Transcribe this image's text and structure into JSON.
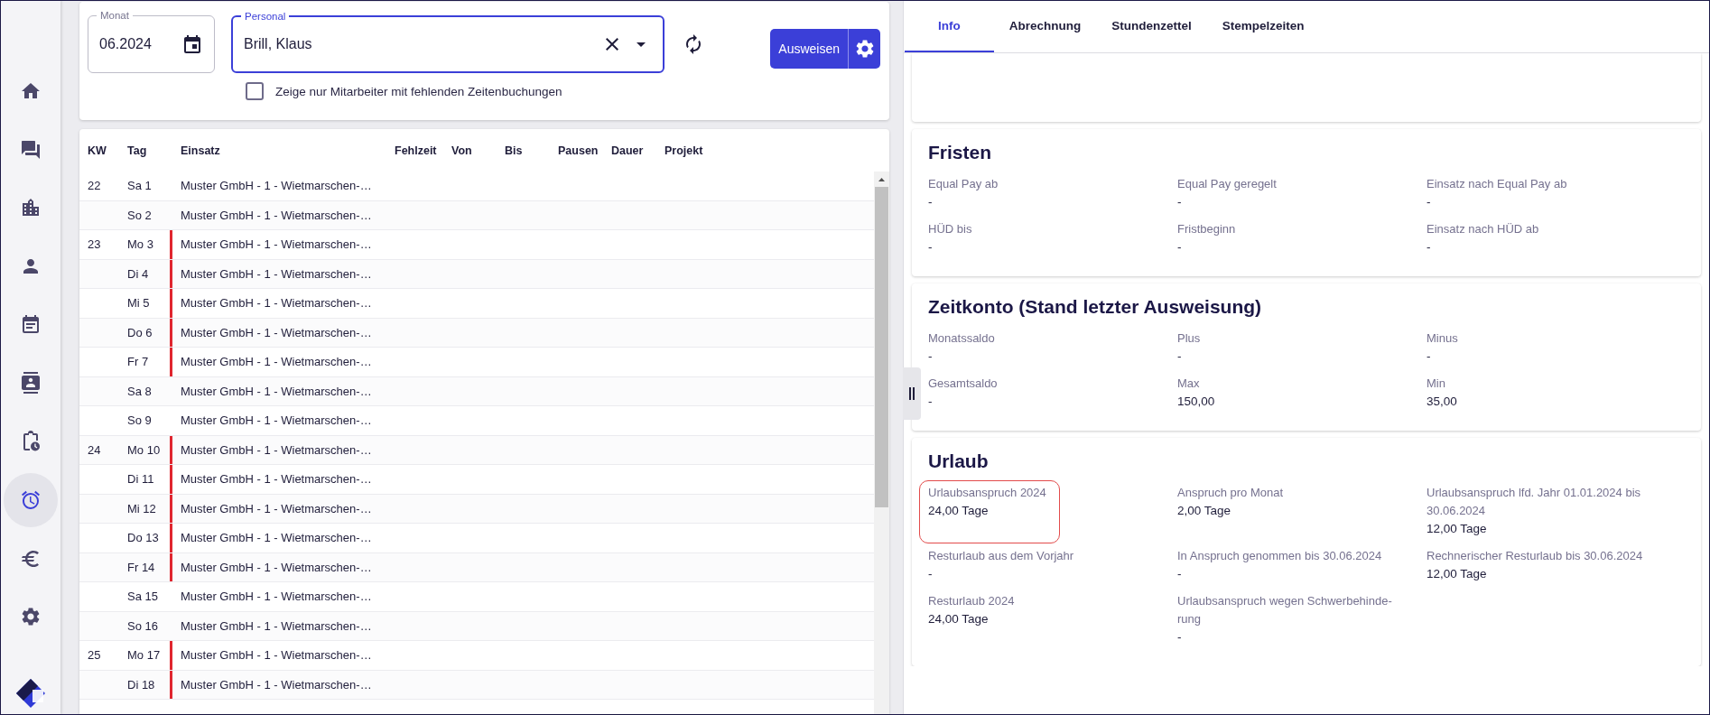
{
  "sidebar": {
    "items": [
      {
        "kind": "home",
        "selected": false
      },
      {
        "kind": "chat",
        "selected": false
      },
      {
        "kind": "city",
        "selected": false
      },
      {
        "kind": "person",
        "selected": false
      },
      {
        "kind": "calendar",
        "selected": false
      },
      {
        "kind": "contact",
        "selected": false
      },
      {
        "kind": "clipboard",
        "selected": false
      },
      {
        "kind": "alarm",
        "selected": true
      },
      {
        "kind": "euro",
        "selected": false
      },
      {
        "kind": "settings",
        "selected": false
      }
    ]
  },
  "filter": {
    "month_field": {
      "label": "Monat",
      "value": "06.2024"
    },
    "personal_field": {
      "label": "Personal",
      "value": "Brill, Klaus",
      "focused": true
    },
    "primary_button": "Ausweisen",
    "missing_only": {
      "label": "Zeige nur Mitarbeiter mit fehlenden Zeitenbuchungen",
      "checked": false
    }
  },
  "table": {
    "columns": [
      "KW",
      "Tag",
      "Einsatz",
      "Fehlzeit",
      "Von",
      "Bis",
      "Pausen",
      "Dauer",
      "Projekt"
    ],
    "rows": [
      {
        "kw": "22",
        "tag": "Sa 1",
        "einsatz": "Muster GmbH - 1 - Wietmarschen-…",
        "marked": false
      },
      {
        "tag": "So 2",
        "einsatz": "Muster GmbH - 1 - Wietmarschen-…",
        "marked": false
      },
      {
        "kw": "23",
        "tag": "Mo 3",
        "einsatz": "Muster GmbH - 1 - Wietmarschen-…",
        "marked": true
      },
      {
        "tag": "Di 4",
        "einsatz": "Muster GmbH - 1 - Wietmarschen-…",
        "marked": true
      },
      {
        "tag": "Mi 5",
        "einsatz": "Muster GmbH - 1 - Wietmarschen-…",
        "marked": true
      },
      {
        "tag": "Do 6",
        "einsatz": "Muster GmbH - 1 - Wietmarschen-…",
        "marked": true
      },
      {
        "tag": "Fr 7",
        "einsatz": "Muster GmbH - 1 - Wietmarschen-…",
        "marked": true
      },
      {
        "tag": "Sa 8",
        "einsatz": "Muster GmbH - 1 - Wietmarschen-…",
        "marked": false
      },
      {
        "tag": "So 9",
        "einsatz": "Muster GmbH - 1 - Wietmarschen-…",
        "marked": false
      },
      {
        "kw": "24",
        "tag": "Mo 10",
        "einsatz": "Muster GmbH - 1 - Wietmarschen-…",
        "marked": true
      },
      {
        "tag": "Di 11",
        "einsatz": "Muster GmbH - 1 - Wietmarschen-…",
        "marked": true
      },
      {
        "tag": "Mi 12",
        "einsatz": "Muster GmbH - 1 - Wietmarschen-…",
        "marked": true
      },
      {
        "tag": "Do 13",
        "einsatz": "Muster GmbH - 1 - Wietmarschen-…",
        "marked": true
      },
      {
        "tag": "Fr 14",
        "einsatz": "Muster GmbH - 1 - Wietmarschen-…",
        "marked": true
      },
      {
        "tag": "Sa 15",
        "einsatz": "Muster GmbH - 1 - Wietmarschen-…",
        "marked": false
      },
      {
        "tag": "So 16",
        "einsatz": "Muster GmbH - 1 - Wietmarschen-…",
        "marked": false
      },
      {
        "kw": "25",
        "tag": "Mo 17",
        "einsatz": "Muster GmbH - 1 - Wietmarschen-…",
        "marked": true
      },
      {
        "tag": "Di 18",
        "einsatz": "Muster GmbH - 1 - Wietmarschen-…",
        "marked": true
      }
    ]
  },
  "tabs": [
    {
      "label": "Info",
      "selected": true
    },
    {
      "label": "Abrechnung",
      "selected": false
    },
    {
      "label": "Stundenzettel",
      "selected": false
    },
    {
      "label": "Stempelzeiten",
      "selected": false
    }
  ],
  "cards": [
    {
      "title": "Fristen",
      "fields": [
        {
          "label": "Equal Pay ab",
          "value": "-",
          "highlighted": false
        },
        {
          "label": "Equal Pay geregelt",
          "value": "-",
          "highlighted": false
        },
        {
          "label": "Einsatz nach Equal Pay ab",
          "value": "-",
          "highlighted": false
        },
        {
          "label": "HÜD bis",
          "value": "-",
          "highlighted": false
        },
        {
          "label": "Fristbeginn",
          "value": "-",
          "highlighted": false
        },
        {
          "label": "Einsatz nach HÜD ab",
          "value": "-",
          "highlighted": false
        }
      ]
    },
    {
      "title": "Zeitkonto (Stand letzter Ausweisung)",
      "fields": [
        {
          "label": "Monatssaldo",
          "value": "-",
          "highlighted": false
        },
        {
          "label": "Plus",
          "value": "-",
          "highlighted": false
        },
        {
          "label": "Minus",
          "value": "-",
          "highlighted": false
        },
        {
          "label": "Gesamtsaldo",
          "value": "-",
          "highlighted": false
        },
        {
          "label": "Max",
          "value": "150,00",
          "highlighted": false
        },
        {
          "label": "Min",
          "value": "35,00",
          "highlighted": false
        }
      ]
    },
    {
      "title": "Urlaub",
      "fields": [
        {
          "label": "Urlaubsanspruch 2024",
          "value": "24,00 Tage",
          "highlighted": true
        },
        {
          "label": "Anspruch pro Monat",
          "value": "2,00 Tage",
          "highlighted": false
        },
        {
          "label": "Urlaubsanspruch lfd. Jahr 01.01.2024 bis 30.06.2024",
          "value": "12,00 Tage",
          "highlighted": false
        },
        {
          "label": "Resturlaub aus dem Vorjahr",
          "value": "-",
          "highlighted": false
        },
        {
          "label": "In Anspruch genommen bis 30.06.2024",
          "value": "-",
          "highlighted": false
        },
        {
          "label": "Rechnerischer Resturlaub bis 30.06.2024",
          "value": "12,00 Tage",
          "highlighted": false
        },
        {
          "label": "Resturlaub 2024",
          "value": "24,00 Tage",
          "highlighted": false
        },
        {
          "label": "Urlaubsanspruch wegen Schwerbehinde-rung",
          "value": "-",
          "highlighted": false
        }
      ]
    }
  ]
}
